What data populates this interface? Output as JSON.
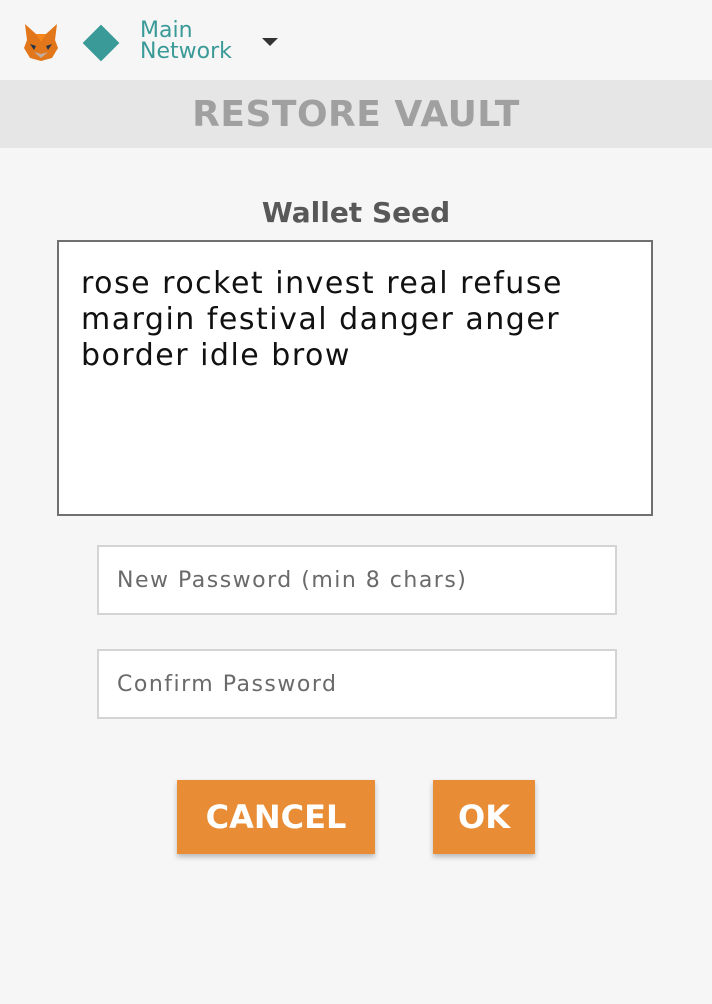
{
  "header": {
    "network_name": "Main\nNetwork",
    "network_color": "#3a9a98"
  },
  "title": "RESTORE VAULT",
  "seed": {
    "label": "Wallet Seed",
    "value": "rose rocket invest real refuse margin festival danger anger border idle brow"
  },
  "password": {
    "new_placeholder": "New Password (min 8 chars)",
    "confirm_placeholder": "Confirm Password"
  },
  "buttons": {
    "cancel": "CANCEL",
    "ok": "OK",
    "color": "#e98c36"
  }
}
